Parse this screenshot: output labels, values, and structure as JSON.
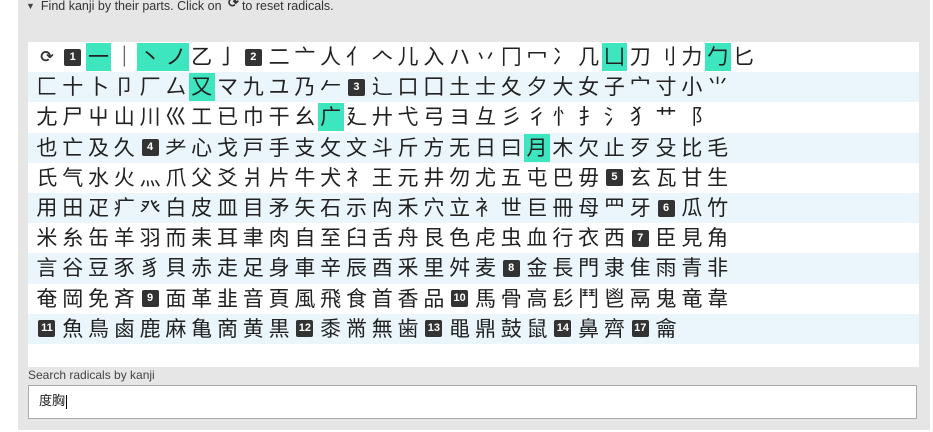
{
  "header": {
    "toggle_icon": "triangle-down-icon",
    "text_before": "Find kanji by their parts. Click on",
    "reload_glyph": "⟳",
    "text_after": "to reset radicals."
  },
  "colors": {
    "selected": "#3ee6c0",
    "alt_row": "#eaf6fc",
    "stroke_badge": "#333333"
  },
  "rows": [
    [
      {
        "t": "reset",
        "v": "⟳"
      },
      {
        "t": "num",
        "v": "1"
      },
      {
        "t": "rad",
        "v": "一",
        "sel": true
      },
      {
        "t": "rad",
        "v": "｜"
      },
      {
        "t": "rad",
        "v": "丶",
        "sel": true
      },
      {
        "t": "rad",
        "v": "ノ",
        "sel": true
      },
      {
        "t": "rad",
        "v": "乙"
      },
      {
        "t": "rad",
        "v": "亅"
      },
      {
        "t": "num",
        "v": "2"
      },
      {
        "t": "rad",
        "v": "二"
      },
      {
        "t": "rad",
        "v": "亠"
      },
      {
        "t": "rad",
        "v": "人"
      },
      {
        "t": "rad",
        "v": "亻"
      },
      {
        "t": "rad",
        "v": "𠆢"
      },
      {
        "t": "rad",
        "v": "儿"
      },
      {
        "t": "rad",
        "v": "入"
      },
      {
        "t": "rad",
        "v": "ハ"
      },
      {
        "t": "rad",
        "v": "丷"
      },
      {
        "t": "rad",
        "v": "冂"
      },
      {
        "t": "rad",
        "v": "冖"
      },
      {
        "t": "rad",
        "v": "冫"
      },
      {
        "t": "rad",
        "v": "几"
      },
      {
        "t": "rad",
        "v": "凵",
        "sel": true
      },
      {
        "t": "rad",
        "v": "刀"
      },
      {
        "t": "rad",
        "v": "刂"
      },
      {
        "t": "rad",
        "v": "力"
      },
      {
        "t": "rad",
        "v": "勹",
        "sel": true
      },
      {
        "t": "rad",
        "v": "匕"
      }
    ],
    [
      {
        "t": "rad",
        "v": "匚"
      },
      {
        "t": "rad",
        "v": "十"
      },
      {
        "t": "rad",
        "v": "卜"
      },
      {
        "t": "rad",
        "v": "卩"
      },
      {
        "t": "rad",
        "v": "厂"
      },
      {
        "t": "rad",
        "v": "厶"
      },
      {
        "t": "rad",
        "v": "又",
        "sel": true
      },
      {
        "t": "rad",
        "v": "マ"
      },
      {
        "t": "rad",
        "v": "九"
      },
      {
        "t": "rad",
        "v": "ユ"
      },
      {
        "t": "rad",
        "v": "乃"
      },
      {
        "t": "rad",
        "v": "𠂉"
      },
      {
        "t": "num",
        "v": "3"
      },
      {
        "t": "rad",
        "v": "⻌"
      },
      {
        "t": "rad",
        "v": "口"
      },
      {
        "t": "rad",
        "v": "囗"
      },
      {
        "t": "rad",
        "v": "土"
      },
      {
        "t": "rad",
        "v": "士"
      },
      {
        "t": "rad",
        "v": "夂"
      },
      {
        "t": "rad",
        "v": "夕"
      },
      {
        "t": "rad",
        "v": "大"
      },
      {
        "t": "rad",
        "v": "女"
      },
      {
        "t": "rad",
        "v": "子"
      },
      {
        "t": "rad",
        "v": "宀"
      },
      {
        "t": "rad",
        "v": "寸"
      },
      {
        "t": "rad",
        "v": "小"
      },
      {
        "t": "rad",
        "v": "⺌"
      }
    ],
    [
      {
        "t": "rad",
        "v": "尢"
      },
      {
        "t": "rad",
        "v": "尸"
      },
      {
        "t": "rad",
        "v": "屮"
      },
      {
        "t": "rad",
        "v": "山"
      },
      {
        "t": "rad",
        "v": "川"
      },
      {
        "t": "rad",
        "v": "巛"
      },
      {
        "t": "rad",
        "v": "工"
      },
      {
        "t": "rad",
        "v": "已"
      },
      {
        "t": "rad",
        "v": "巾"
      },
      {
        "t": "rad",
        "v": "干"
      },
      {
        "t": "rad",
        "v": "幺"
      },
      {
        "t": "rad",
        "v": "广",
        "sel": true
      },
      {
        "t": "rad",
        "v": "廴"
      },
      {
        "t": "rad",
        "v": "廾"
      },
      {
        "t": "rad",
        "v": "弋"
      },
      {
        "t": "rad",
        "v": "弓"
      },
      {
        "t": "rad",
        "v": "ヨ"
      },
      {
        "t": "rad",
        "v": "彑"
      },
      {
        "t": "rad",
        "v": "彡"
      },
      {
        "t": "rad",
        "v": "彳"
      },
      {
        "t": "rad",
        "v": "⺖"
      },
      {
        "t": "rad",
        "v": "⺘"
      },
      {
        "t": "rad",
        "v": "⺡"
      },
      {
        "t": "rad",
        "v": "⺨"
      },
      {
        "t": "rad",
        "v": "⺾"
      },
      {
        "t": "rad",
        "v": "⻏"
      }
    ],
    [
      {
        "t": "rad",
        "v": "也"
      },
      {
        "t": "rad",
        "v": "亡"
      },
      {
        "t": "rad",
        "v": "及"
      },
      {
        "t": "rad",
        "v": "久"
      },
      {
        "t": "num",
        "v": "4"
      },
      {
        "t": "rad",
        "v": "⺹"
      },
      {
        "t": "rad",
        "v": "心"
      },
      {
        "t": "rad",
        "v": "戈"
      },
      {
        "t": "rad",
        "v": "戸"
      },
      {
        "t": "rad",
        "v": "手"
      },
      {
        "t": "rad",
        "v": "支"
      },
      {
        "t": "rad",
        "v": "攵"
      },
      {
        "t": "rad",
        "v": "文"
      },
      {
        "t": "rad",
        "v": "斗"
      },
      {
        "t": "rad",
        "v": "斤"
      },
      {
        "t": "rad",
        "v": "方"
      },
      {
        "t": "rad",
        "v": "无"
      },
      {
        "t": "rad",
        "v": "日"
      },
      {
        "t": "rad",
        "v": "曰"
      },
      {
        "t": "rad",
        "v": "月",
        "sel": true
      },
      {
        "t": "rad",
        "v": "木"
      },
      {
        "t": "rad",
        "v": "欠"
      },
      {
        "t": "rad",
        "v": "止"
      },
      {
        "t": "rad",
        "v": "歹"
      },
      {
        "t": "rad",
        "v": "殳"
      },
      {
        "t": "rad",
        "v": "比"
      },
      {
        "t": "rad",
        "v": "毛"
      }
    ],
    [
      {
        "t": "rad",
        "v": "氏"
      },
      {
        "t": "rad",
        "v": "气"
      },
      {
        "t": "rad",
        "v": "水"
      },
      {
        "t": "rad",
        "v": "火"
      },
      {
        "t": "rad",
        "v": "⺣"
      },
      {
        "t": "rad",
        "v": "爪"
      },
      {
        "t": "rad",
        "v": "父"
      },
      {
        "t": "rad",
        "v": "爻"
      },
      {
        "t": "rad",
        "v": "爿"
      },
      {
        "t": "rad",
        "v": "片"
      },
      {
        "t": "rad",
        "v": "牛"
      },
      {
        "t": "rad",
        "v": "犬"
      },
      {
        "t": "rad",
        "v": "⺭"
      },
      {
        "t": "rad",
        "v": "王"
      },
      {
        "t": "rad",
        "v": "元"
      },
      {
        "t": "rad",
        "v": "井"
      },
      {
        "t": "rad",
        "v": "勿"
      },
      {
        "t": "rad",
        "v": "尤"
      },
      {
        "t": "rad",
        "v": "五"
      },
      {
        "t": "rad",
        "v": "屯"
      },
      {
        "t": "rad",
        "v": "巴"
      },
      {
        "t": "rad",
        "v": "毋"
      },
      {
        "t": "num",
        "v": "5"
      },
      {
        "t": "rad",
        "v": "玄"
      },
      {
        "t": "rad",
        "v": "瓦"
      },
      {
        "t": "rad",
        "v": "甘"
      },
      {
        "t": "rad",
        "v": "生"
      }
    ],
    [
      {
        "t": "rad",
        "v": "用"
      },
      {
        "t": "rad",
        "v": "田"
      },
      {
        "t": "rad",
        "v": "疋"
      },
      {
        "t": "rad",
        "v": "疒"
      },
      {
        "t": "rad",
        "v": "癶"
      },
      {
        "t": "rad",
        "v": "白"
      },
      {
        "t": "rad",
        "v": "皮"
      },
      {
        "t": "rad",
        "v": "皿"
      },
      {
        "t": "rad",
        "v": "目"
      },
      {
        "t": "rad",
        "v": "矛"
      },
      {
        "t": "rad",
        "v": "矢"
      },
      {
        "t": "rad",
        "v": "石"
      },
      {
        "t": "rad",
        "v": "示"
      },
      {
        "t": "rad",
        "v": "禸"
      },
      {
        "t": "rad",
        "v": "禾"
      },
      {
        "t": "rad",
        "v": "穴"
      },
      {
        "t": "rad",
        "v": "立"
      },
      {
        "t": "rad",
        "v": "⻂"
      },
      {
        "t": "rad",
        "v": "世"
      },
      {
        "t": "rad",
        "v": "巨"
      },
      {
        "t": "rad",
        "v": "冊"
      },
      {
        "t": "rad",
        "v": "母"
      },
      {
        "t": "rad",
        "v": "⺲"
      },
      {
        "t": "rad",
        "v": "牙"
      },
      {
        "t": "num",
        "v": "6"
      },
      {
        "t": "rad",
        "v": "瓜"
      },
      {
        "t": "rad",
        "v": "竹"
      }
    ],
    [
      {
        "t": "rad",
        "v": "米"
      },
      {
        "t": "rad",
        "v": "糸"
      },
      {
        "t": "rad",
        "v": "缶"
      },
      {
        "t": "rad",
        "v": "羊"
      },
      {
        "t": "rad",
        "v": "羽"
      },
      {
        "t": "rad",
        "v": "而"
      },
      {
        "t": "rad",
        "v": "耒"
      },
      {
        "t": "rad",
        "v": "耳"
      },
      {
        "t": "rad",
        "v": "聿"
      },
      {
        "t": "rad",
        "v": "肉"
      },
      {
        "t": "rad",
        "v": "自"
      },
      {
        "t": "rad",
        "v": "至"
      },
      {
        "t": "rad",
        "v": "臼"
      },
      {
        "t": "rad",
        "v": "舌"
      },
      {
        "t": "rad",
        "v": "舟"
      },
      {
        "t": "rad",
        "v": "艮"
      },
      {
        "t": "rad",
        "v": "色"
      },
      {
        "t": "rad",
        "v": "虍"
      },
      {
        "t": "rad",
        "v": "虫"
      },
      {
        "t": "rad",
        "v": "血"
      },
      {
        "t": "rad",
        "v": "行"
      },
      {
        "t": "rad",
        "v": "衣"
      },
      {
        "t": "rad",
        "v": "西"
      },
      {
        "t": "num",
        "v": "7"
      },
      {
        "t": "rad",
        "v": "臣"
      },
      {
        "t": "rad",
        "v": "見"
      },
      {
        "t": "rad",
        "v": "角"
      }
    ],
    [
      {
        "t": "rad",
        "v": "言"
      },
      {
        "t": "rad",
        "v": "谷"
      },
      {
        "t": "rad",
        "v": "豆"
      },
      {
        "t": "rad",
        "v": "豕"
      },
      {
        "t": "rad",
        "v": "豸"
      },
      {
        "t": "rad",
        "v": "貝"
      },
      {
        "t": "rad",
        "v": "赤"
      },
      {
        "t": "rad",
        "v": "走"
      },
      {
        "t": "rad",
        "v": "足"
      },
      {
        "t": "rad",
        "v": "身"
      },
      {
        "t": "rad",
        "v": "車"
      },
      {
        "t": "rad",
        "v": "辛"
      },
      {
        "t": "rad",
        "v": "辰"
      },
      {
        "t": "rad",
        "v": "酉"
      },
      {
        "t": "rad",
        "v": "釆"
      },
      {
        "t": "rad",
        "v": "里"
      },
      {
        "t": "rad",
        "v": "舛"
      },
      {
        "t": "rad",
        "v": "麦"
      },
      {
        "t": "num",
        "v": "8"
      },
      {
        "t": "rad",
        "v": "金"
      },
      {
        "t": "rad",
        "v": "長"
      },
      {
        "t": "rad",
        "v": "門"
      },
      {
        "t": "rad",
        "v": "隶"
      },
      {
        "t": "rad",
        "v": "隹"
      },
      {
        "t": "rad",
        "v": "雨"
      },
      {
        "t": "rad",
        "v": "青"
      },
      {
        "t": "rad",
        "v": "非"
      }
    ],
    [
      {
        "t": "rad",
        "v": "奄"
      },
      {
        "t": "rad",
        "v": "岡"
      },
      {
        "t": "rad",
        "v": "免"
      },
      {
        "t": "rad",
        "v": "斉"
      },
      {
        "t": "num",
        "v": "9"
      },
      {
        "t": "rad",
        "v": "面"
      },
      {
        "t": "rad",
        "v": "革"
      },
      {
        "t": "rad",
        "v": "韭"
      },
      {
        "t": "rad",
        "v": "音"
      },
      {
        "t": "rad",
        "v": "頁"
      },
      {
        "t": "rad",
        "v": "風"
      },
      {
        "t": "rad",
        "v": "飛"
      },
      {
        "t": "rad",
        "v": "食"
      },
      {
        "t": "rad",
        "v": "首"
      },
      {
        "t": "rad",
        "v": "香"
      },
      {
        "t": "rad",
        "v": "品"
      },
      {
        "t": "num",
        "v": "10"
      },
      {
        "t": "rad",
        "v": "馬"
      },
      {
        "t": "rad",
        "v": "骨"
      },
      {
        "t": "rad",
        "v": "高"
      },
      {
        "t": "rad",
        "v": "髟"
      },
      {
        "t": "rad",
        "v": "鬥"
      },
      {
        "t": "rad",
        "v": "鬯"
      },
      {
        "t": "rad",
        "v": "鬲"
      },
      {
        "t": "rad",
        "v": "鬼"
      },
      {
        "t": "rad",
        "v": "竜"
      },
      {
        "t": "rad",
        "v": "韋"
      }
    ],
    [
      {
        "t": "num",
        "v": "11"
      },
      {
        "t": "rad",
        "v": "魚"
      },
      {
        "t": "rad",
        "v": "鳥"
      },
      {
        "t": "rad",
        "v": "鹵"
      },
      {
        "t": "rad",
        "v": "鹿"
      },
      {
        "t": "rad",
        "v": "麻"
      },
      {
        "t": "rad",
        "v": "亀"
      },
      {
        "t": "rad",
        "v": "啇"
      },
      {
        "t": "rad",
        "v": "黄"
      },
      {
        "t": "rad",
        "v": "黒"
      },
      {
        "t": "num",
        "v": "12"
      },
      {
        "t": "rad",
        "v": "黍"
      },
      {
        "t": "rad",
        "v": "黹"
      },
      {
        "t": "rad",
        "v": "無"
      },
      {
        "t": "rad",
        "v": "歯"
      },
      {
        "t": "num",
        "v": "13"
      },
      {
        "t": "rad",
        "v": "黽"
      },
      {
        "t": "rad",
        "v": "鼎"
      },
      {
        "t": "rad",
        "v": "鼓"
      },
      {
        "t": "rad",
        "v": "鼠"
      },
      {
        "t": "num",
        "v": "14"
      },
      {
        "t": "rad",
        "v": "鼻"
      },
      {
        "t": "rad",
        "v": "齊"
      },
      {
        "t": "num",
        "v": "17"
      },
      {
        "t": "rad",
        "v": "龠"
      }
    ]
  ],
  "search": {
    "label": "Search radicals by kanji",
    "value": "度胸"
  }
}
